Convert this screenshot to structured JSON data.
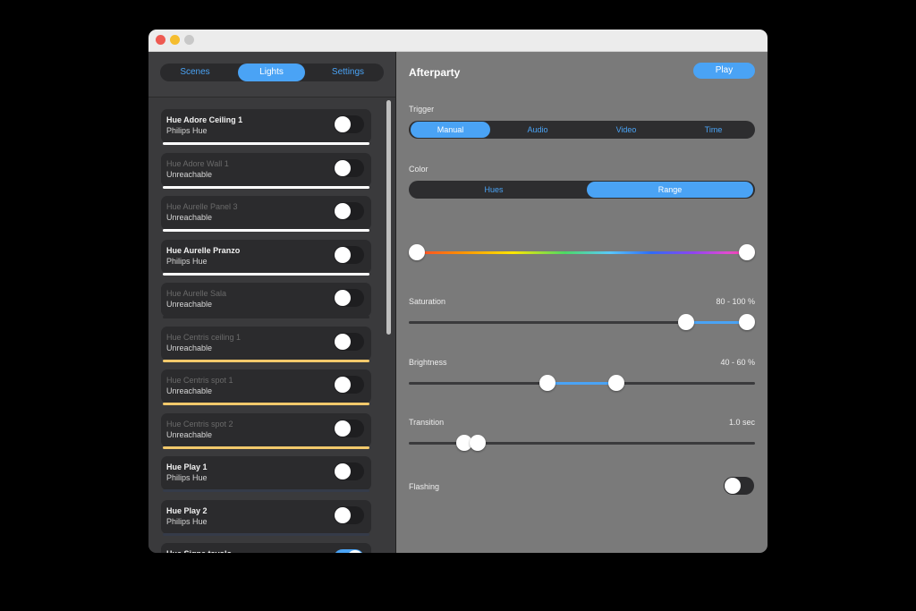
{
  "tabs": [
    {
      "label": "Scenes",
      "active": false
    },
    {
      "label": "Lights",
      "active": true
    },
    {
      "label": "Settings",
      "active": false
    }
  ],
  "lights": [
    {
      "name": "Hue Adore Ceiling 1",
      "status": "Philips Hue",
      "reachable": true,
      "on": false,
      "bar_color": "#ffffff"
    },
    {
      "name": "Hue Adore Wall 1",
      "status": "Unreachable",
      "reachable": false,
      "on": false,
      "bar_color": "#ffffff"
    },
    {
      "name": "Hue Aurelle Panel 3",
      "status": "Unreachable",
      "reachable": false,
      "on": false,
      "bar_color": "#ffffff"
    },
    {
      "name": "Hue Aurelle Pranzo",
      "status": "Philips Hue",
      "reachable": true,
      "on": false,
      "bar_color": "#ffffff"
    },
    {
      "name": "Hue Aurelle Sala",
      "status": "Unreachable",
      "reachable": false,
      "on": false,
      "bar_color": "#2b2b2d"
    },
    {
      "name": "Hue Centris ceiling 1",
      "status": "Unreachable",
      "reachable": false,
      "on": false,
      "bar_color": "#f2c96b"
    },
    {
      "name": "Hue Centris spot 1",
      "status": "Unreachable",
      "reachable": false,
      "on": false,
      "bar_color": "#f2c96b"
    },
    {
      "name": "Hue Centris spot 2",
      "status": "Unreachable",
      "reachable": false,
      "on": false,
      "bar_color": "#f2c96b"
    },
    {
      "name": "Hue Play 1",
      "status": "Philips Hue",
      "reachable": true,
      "on": false,
      "bar_color": "#353b49"
    },
    {
      "name": "Hue Play 2",
      "status": "Philips Hue",
      "reachable": true,
      "on": false,
      "bar_color": "#353b49"
    },
    {
      "name": "Hue Signe tavolo",
      "status": "",
      "reachable": true,
      "on": true,
      "bar_color": "#2b2b2d"
    }
  ],
  "scene": {
    "title": "Afterparty",
    "play_label": "Play",
    "trigger": {
      "label": "Trigger",
      "options": [
        {
          "label": "Manual",
          "active": true
        },
        {
          "label": "Audio",
          "active": false
        },
        {
          "label": "Video",
          "active": false
        },
        {
          "label": "Time",
          "active": false
        }
      ]
    },
    "color": {
      "label": "Color",
      "options": [
        {
          "label": "Hues",
          "active": false
        },
        {
          "label": "Range",
          "active": true
        }
      ],
      "range": [
        0,
        1
      ]
    },
    "saturation": {
      "label": "Saturation",
      "value_text": "80 - 100 %",
      "low": 80,
      "high": 100
    },
    "brightness": {
      "label": "Brightness",
      "value_text": "40 - 60 %",
      "low": 40,
      "high": 60
    },
    "transition": {
      "label": "Transition",
      "value_text": "1.0 sec",
      "low": 0.16,
      "high": 0.2
    },
    "flashing": {
      "label": "Flashing",
      "on": false
    }
  },
  "colors": {
    "accent": "#4aa3f5",
    "sidebar_bg": "#3a3a3c",
    "main_bg": "#7a7a7a"
  }
}
